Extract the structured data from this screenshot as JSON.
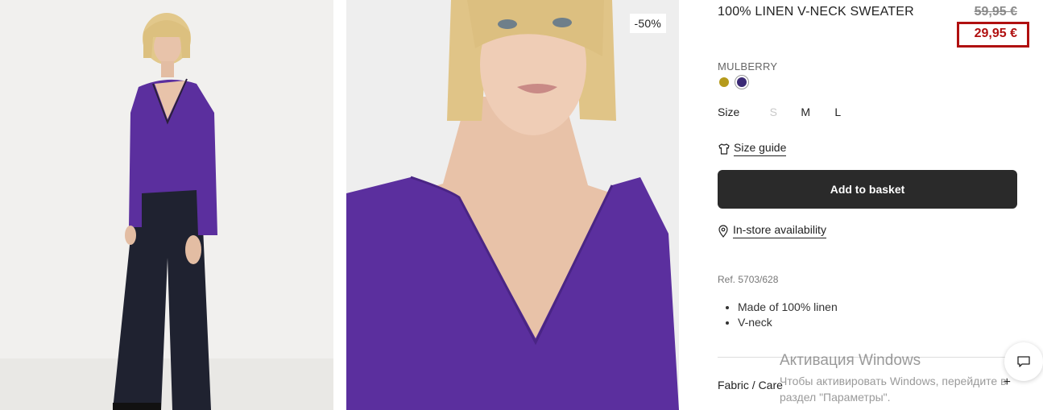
{
  "product": {
    "title": "100% LINEN V-NECK SWEATER",
    "old_price": "59,95 €",
    "new_price": "29,95 €",
    "discount_badge": "-50%",
    "color_name": "MULBERRY",
    "swatches": [
      {
        "name": "mustard",
        "color": "#b59a1b"
      },
      {
        "name": "mulberry",
        "color": "#3b2a75",
        "selected": true
      }
    ],
    "size_label": "Size",
    "sizes": [
      {
        "label": "S",
        "available": false
      },
      {
        "label": "M",
        "available": true
      },
      {
        "label": "L",
        "available": true
      }
    ],
    "size_guide": "Size guide",
    "add_to_basket": "Add to basket",
    "in_store": "In-store availability",
    "ref": "Ref. 5703/628",
    "features": [
      "Made of 100% linen",
      "V-neck"
    ],
    "fabric_care": "Fabric / Care",
    "expand_symbol": "+"
  },
  "watermark": {
    "title": "Активация Windows",
    "line1": "Чтобы активировать Windows, перейдите в",
    "line2": "раздел \"Параметры\"."
  },
  "colors": {
    "accent_red": "#b01010",
    "button_dark": "#2a2a2a",
    "sweater_purple": "#5b2f9e"
  },
  "icons": {
    "size_guide": "tshirt-icon",
    "store": "location-pin-icon",
    "chat": "chat-icon"
  }
}
